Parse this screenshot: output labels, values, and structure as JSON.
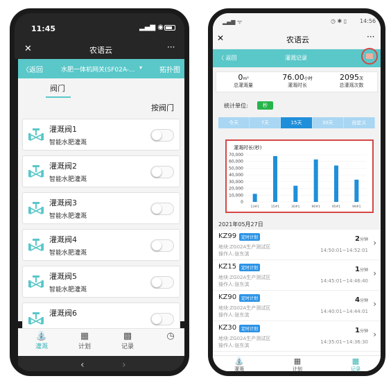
{
  "left": {
    "status_time": "11:45",
    "title": "农语云",
    "nav": {
      "back": "返回",
      "gateway": "水肥一体机网关(SF02A-...",
      "topology": "拓扑图"
    },
    "tab": "阀门",
    "by_valve": "按阀门",
    "valves": [
      {
        "name": "灌溉阀1",
        "sub": "智能水肥灌溉"
      },
      {
        "name": "灌溉阀2",
        "sub": "智能水肥灌溉"
      },
      {
        "name": "灌溉阀3",
        "sub": "智能水肥灌溉"
      },
      {
        "name": "灌溉阀4",
        "sub": "智能水肥灌溉"
      },
      {
        "name": "灌溉阀5",
        "sub": "智能水肥灌溉"
      },
      {
        "name": "灌溉阀6",
        "sub": ""
      }
    ],
    "tabs": [
      "灌溉",
      "计划",
      "记录"
    ],
    "accent": "#5ac7c9"
  },
  "right": {
    "status_time": "14:56",
    "title": "农语云",
    "nav": {
      "back": "返回",
      "title": "灌溉记录"
    },
    "stats": [
      {
        "value": "0",
        "unit": "m³",
        "label": "总灌溉量"
      },
      {
        "value": "76.00",
        "unit": "小时",
        "label": "灌溉时长"
      },
      {
        "value": "2095",
        "unit": "次",
        "label": "总灌溉次数"
      }
    ],
    "unit_label": "统计单位:",
    "unit_value": "秒",
    "ranges": [
      "今天",
      "7天",
      "15天",
      "30天",
      "自定义"
    ],
    "active_range": "15天",
    "date_header": "2021年05月27日",
    "records": [
      {
        "kz": "KZ99",
        "badge": "定时计划",
        "loc": "地块:ZG02A生产测试区",
        "op": "操作人:张东滨",
        "dur": "2",
        "dur_unit": "分钟",
        "time": "14:50:01~14:52:01"
      },
      {
        "kz": "KZ15",
        "badge": "定时计划",
        "loc": "地块:ZG02A生产测试区",
        "op": "操作人:张东滨",
        "dur": "1",
        "dur_unit": "分钟",
        "time": "14:45:01~14:46:40"
      },
      {
        "kz": "KZ90",
        "badge": "定时计划",
        "loc": "地块:ZG02A生产测试区",
        "op": "操作人:张东滨",
        "dur": "4",
        "dur_unit": "分钟",
        "time": "14:40:01~14:44:01"
      },
      {
        "kz": "KZ30",
        "badge": "定时计划",
        "loc": "地块:ZG02A生产测试区",
        "op": "操作人:张东滨",
        "dur": "1",
        "dur_unit": "分钟",
        "time": "14:35:01~14:36:30"
      }
    ],
    "tabs": [
      "灌溉",
      "计划",
      "记录"
    ],
    "chart_data": {
      "type": "bar",
      "title": "灌溉时长(秒)",
      "categories": [
        "13#1",
        "15#1",
        "30#1",
        "90#1",
        "95#1",
        "99#1"
      ],
      "values": [
        12000,
        68000,
        24000,
        63000,
        54000,
        33000
      ],
      "ylim": [
        0,
        70000
      ],
      "yticks": [
        "70,000",
        "60,000",
        "50,000",
        "40,000",
        "30,000",
        "20,000",
        "10,000",
        "0"
      ],
      "color": "#1f8fda"
    }
  }
}
